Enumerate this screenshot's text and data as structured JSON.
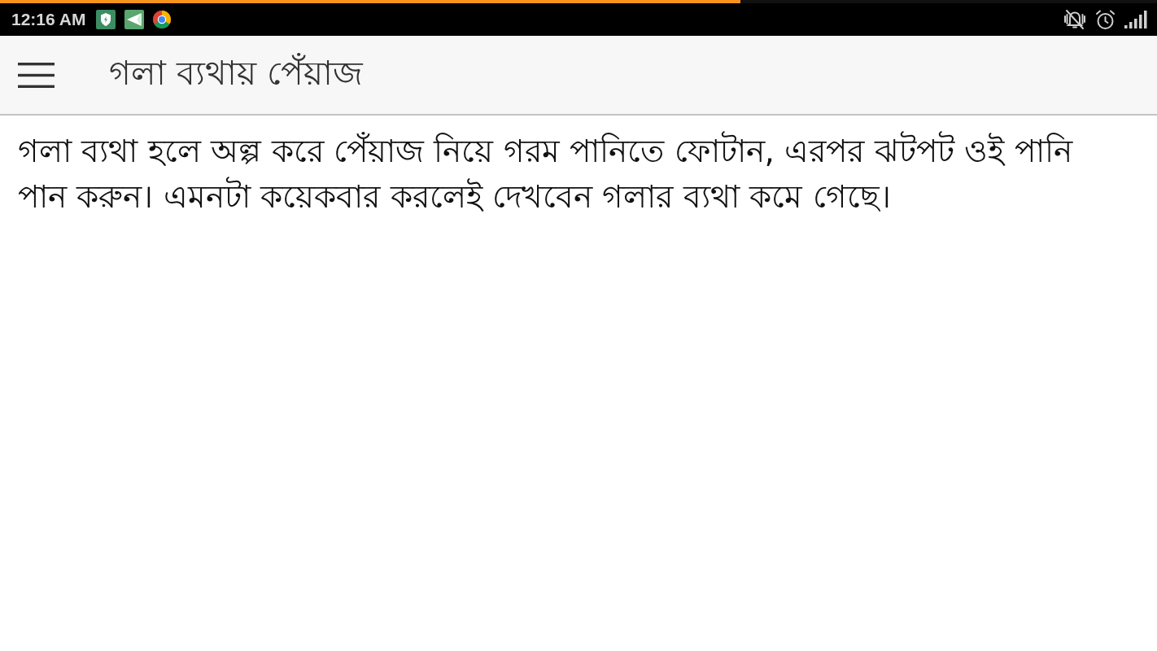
{
  "status_bar": {
    "load_progress": {
      "level": 0.64
    },
    "time": "12:16 AM"
  },
  "app_bar": {
    "title": "গলা ব্যথায় পেঁয়াজ"
  },
  "content": {
    "paragraph": "গলা ব্যথা হলে অল্প করে পেঁয়াজ নিয়ে গরম পানিতে ফোটান, এরপর ঝটপট ওই পানি পান করুন। এমনটা কয়েকবার করলেই দেখবেন গলার ব্যথা কমে গেছে।"
  }
}
